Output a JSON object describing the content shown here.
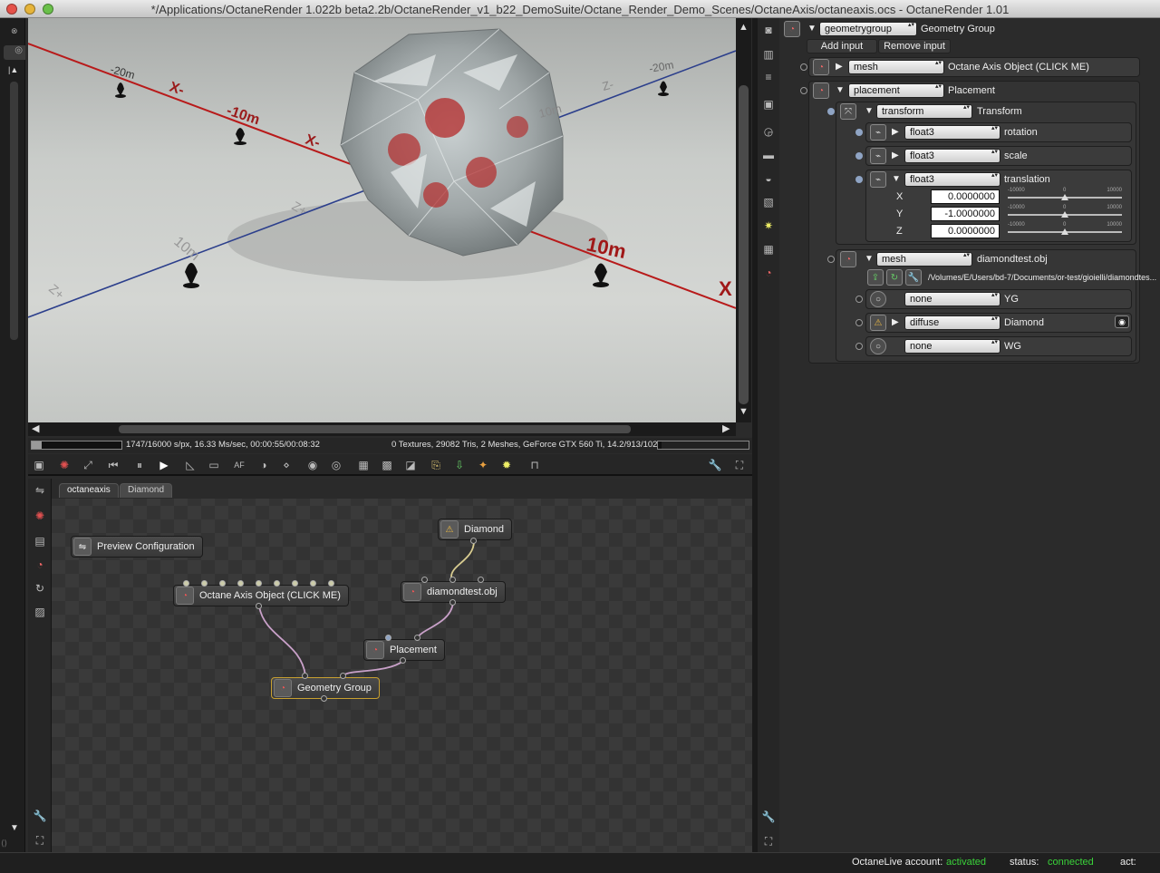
{
  "window": {
    "title": "*/Applications/OctaneRender 1.022b beta2.2b/OctaneRender_v1_b22_DemoSuite/Octane_Render_Demo_Scenes/OctaneAxis/octaneaxis.ocs - OctaneRender 1.01"
  },
  "viewport": {
    "axis_labels": [
      "-20m",
      "X-",
      "-10m",
      "X-",
      "-20m",
      "Z-",
      "10m",
      "Z+",
      "10m",
      "10m",
      "X",
      "Z+"
    ]
  },
  "render_status": {
    "samples": "1747/16000 s/px, 16.33 Ms/sec, 00:00:55/00:08:32",
    "scene_info": "0 Textures, 29082 Tris, 2 Meshes, GeForce GTX 560 Ti, 14.2/913/102..."
  },
  "node_tabs": [
    "octaneaxis",
    "Diamond"
  ],
  "nodes": {
    "preview": "Preview Configuration",
    "axis": "Octane Axis Object (CLICK ME)",
    "diamond": "Diamond",
    "diamond_obj": "diamondtest.obj",
    "placement": "Placement",
    "geometry_group": "Geometry Group"
  },
  "props": {
    "top_type": "geometrygroup",
    "top_name": "Geometry Group",
    "add_input": "Add input",
    "remove_input": "Remove input",
    "mesh_type": "mesh",
    "mesh_name": "Octane Axis Object (CLICK ME)",
    "placement_type": "placement",
    "placement_name": "Placement",
    "transform_type": "transform",
    "transform_name": "Transform",
    "rotation_type": "float3",
    "rotation_name": "rotation",
    "scale_type": "float3",
    "scale_name": "scale",
    "translation_type": "float3",
    "translation_name": "translation",
    "x_label": "X",
    "x_value": "0.0000000",
    "y_label": "Y",
    "y_value": "-1.0000000",
    "z_label": "Z",
    "z_value": "0.0000000",
    "slider_min": "-10000",
    "slider_mid": "0",
    "slider_max": "10000",
    "mesh2_type": "mesh",
    "mesh2_name": "diamondtest.obj",
    "mesh2_path": "/Volumes/E/Users/bd-7/Documents/or-test/gioielli/diamondtes...",
    "yg_type": "none",
    "yg_name": "YG",
    "diamond_type": "diffuse",
    "diamond_name": "Diamond",
    "wg_type": "none",
    "wg_name": "WG"
  },
  "footer": {
    "account_label": "OctaneLive account:",
    "account_value": "activated",
    "status_label": "status:",
    "status_value": "connected",
    "act_label": "act:"
  },
  "colors": {
    "accent_green": "#3ad33a",
    "axis_red": "#b81a1a",
    "axis_blue": "#2c3f8c"
  }
}
